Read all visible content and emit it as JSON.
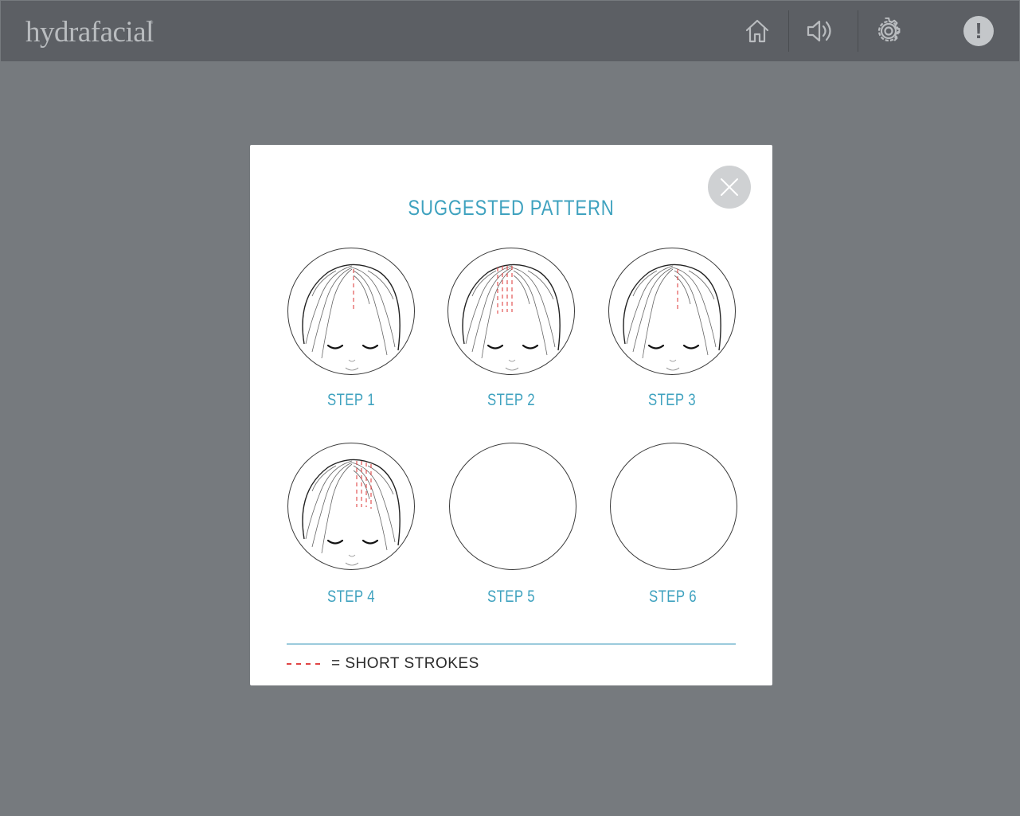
{
  "app": {
    "logo_text": "hydrafacial",
    "logo_mark": "®"
  },
  "topbar": {
    "home_label": "home-icon",
    "audio_label": "speaker-icon",
    "settings_label": "gear-icon",
    "alert_glyph": "!"
  },
  "modal": {
    "title": "SUGGESTED PATTERN",
    "steps": [
      {
        "label": "STEP 1",
        "illustration": "head-top",
        "strokes": "single-center"
      },
      {
        "label": "STEP 2",
        "illustration": "head-top",
        "strokes": "left-of-part"
      },
      {
        "label": "STEP 3",
        "illustration": "head-top",
        "strokes": "single-center"
      },
      {
        "label": "STEP 4",
        "illustration": "head-top",
        "strokes": "right-of-part"
      },
      {
        "label": "STEP 5",
        "illustration": "empty"
      },
      {
        "label": "STEP 6",
        "illustration": "empty"
      }
    ],
    "legend": {
      "text": "= SHORT STROKES",
      "dash_color": "#e04545"
    }
  },
  "colors": {
    "accent": "#3fa2bf",
    "background": "#767a7e",
    "topbar": "#5c5f64",
    "stroke_red": "#e04545"
  }
}
